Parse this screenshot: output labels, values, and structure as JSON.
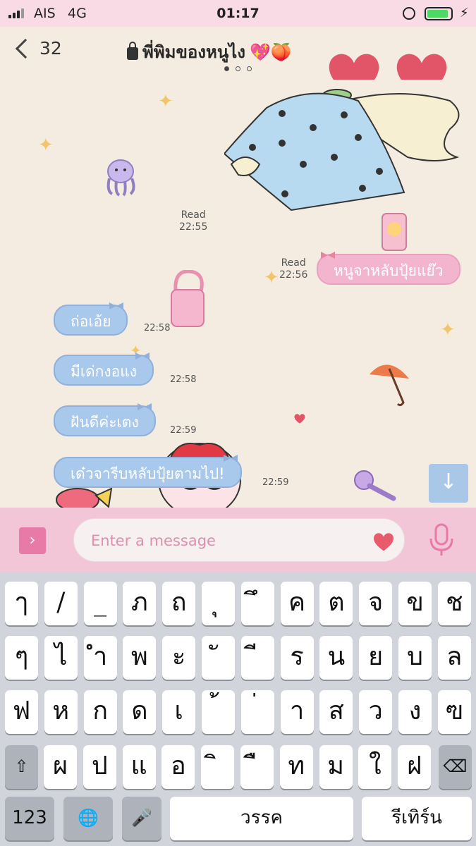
{
  "status_bar": {
    "carrier": "AIS",
    "network": "4G",
    "time": "01:17",
    "battery_level": 0.9
  },
  "header": {
    "back_count": "32",
    "chat_title": "พี่พิมของหนูไง",
    "title_emojis": "💖🍑",
    "page_indicator_count": 3,
    "page_indicator_active": 0
  },
  "messages": [
    {
      "side": "sent",
      "read_label": "Read",
      "time": "22:55",
      "text": ""
    },
    {
      "side": "sent",
      "read_label": "Read",
      "time": "22:56",
      "text": "หนูจาหลับปุ้ยแย๊ว"
    },
    {
      "side": "received",
      "time": "22:58",
      "text": "ถ่อเอ้ย"
    },
    {
      "side": "received",
      "time": "22:58",
      "text": "มีเด่กงอแง"
    },
    {
      "side": "received",
      "time": "22:59",
      "text": "ฝันดีค่ะเตง"
    },
    {
      "side": "received",
      "time": "22:59",
      "text": "เด๋วจารีบหลับปุ้ยตามไป!"
    }
  ],
  "input": {
    "placeholder": "Enter a message",
    "value": ""
  },
  "keyboard": {
    "row1": [
      "ๅ",
      "/",
      "_",
      "ภ",
      "ถ",
      "ุ",
      "ึ",
      "ค",
      "ต",
      "จ",
      "ข",
      "ช"
    ],
    "row2": [
      "ๆ",
      "ไ",
      "ำ",
      "พ",
      "ะ",
      "ั",
      "ี",
      "ร",
      "น",
      "ย",
      "บ",
      "ล"
    ],
    "row3": [
      "ฟ",
      "ห",
      "ก",
      "ด",
      "เ",
      "้",
      "่",
      "า",
      "ส",
      "ว",
      "ง",
      "ฃ"
    ],
    "row4": [
      "ผ",
      "ป",
      "แ",
      "อ",
      "ิ",
      "ื",
      "ท",
      "ม",
      "ใ",
      "ฝ"
    ],
    "numbers_label": "123",
    "space_label": "วรรค",
    "return_label": "รีเทิร์น"
  },
  "colors": {
    "accent_pink": "#e77aa6",
    "received_bubble": "#a8c8ec",
    "sent_bubble": "#f3b5ce"
  }
}
